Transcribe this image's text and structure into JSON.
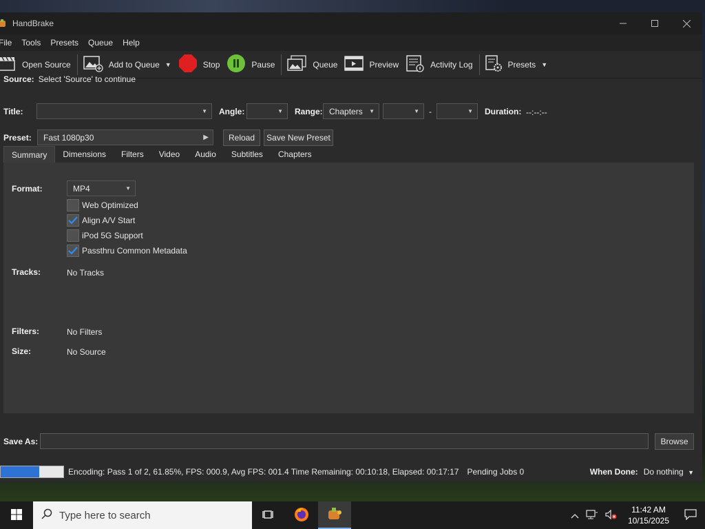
{
  "window": {
    "title": "HandBrake"
  },
  "menu": [
    "File",
    "Tools",
    "Presets",
    "Queue",
    "Help"
  ],
  "toolbar": {
    "open_source": "Open Source",
    "add_to_queue": "Add to Queue",
    "stop": "Stop",
    "pause": "Pause",
    "queue": "Queue",
    "preview": "Preview",
    "activity_log": "Activity Log",
    "presets": "Presets"
  },
  "source": {
    "label": "Source:",
    "value": "Select 'Source' to continue"
  },
  "title_row": {
    "title_label": "Title:",
    "title_value": "",
    "angle_label": "Angle:",
    "angle_value": "",
    "range_label": "Range:",
    "range_value": "Chapters",
    "range_start": "",
    "range_sep": "-",
    "range_end": "",
    "duration_label": "Duration:",
    "duration_value": "--:--:--"
  },
  "preset": {
    "label": "Preset:",
    "value": "Fast 1080p30",
    "reload": "Reload",
    "save_new": "Save New Preset"
  },
  "tabs": [
    "Summary",
    "Dimensions",
    "Filters",
    "Video",
    "Audio",
    "Subtitles",
    "Chapters"
  ],
  "active_tab": "Summary",
  "summary": {
    "format_label": "Format:",
    "format_value": "MP4",
    "options": [
      {
        "label": "Web Optimized",
        "checked": false
      },
      {
        "label": "Align A/V Start",
        "checked": true
      },
      {
        "label": "iPod 5G Support",
        "checked": false
      },
      {
        "label": "Passthru Common Metadata",
        "checked": true
      }
    ],
    "tracks_label": "Tracks:",
    "tracks_value": "No Tracks",
    "filters_label": "Filters:",
    "filters_value": "No Filters",
    "size_label": "Size:",
    "size_value": "No Source"
  },
  "save_as": {
    "label": "Save As:",
    "value": "",
    "browse": "Browse"
  },
  "status": {
    "progress": 0.6185,
    "text": "Encoding: Pass 1 of 2,  61.85%, FPS: 000.9,  Avg FPS: 001.4 Time Remaining: 00:10:18,  Elapsed: 00:17:17",
    "pending": "Pending Jobs 0",
    "when_done_label": "When Done:",
    "when_done_value": "Do nothing"
  },
  "taskbar": {
    "search_placeholder": "Type here to search",
    "time": "11:42 AM",
    "date": "10/15/2025"
  },
  "colors": {
    "progress_fill": "#2f72d6",
    "stop_red": "#e02020",
    "pause_green": "#6ec23a",
    "check_blue": "#1e78d6"
  }
}
